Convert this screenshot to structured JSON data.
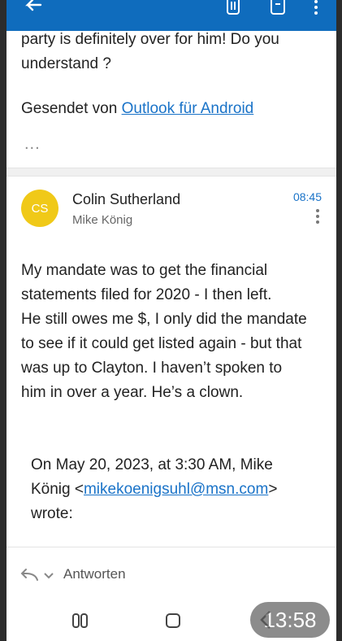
{
  "previous_message": {
    "lines": [
      "party is definitely over for him!  Do you",
      "understand ?"
    ],
    "signature_prefix": "Gesendet von ",
    "signature_link": "Outlook für Android",
    "more": "..."
  },
  "message": {
    "avatar_initials": "CS",
    "sender": "Colin Sutherland",
    "recipient": "Mike König",
    "time": "08:45",
    "body": [
      "My mandate was to get the financial",
      "statements filed for 2020 - I then left.",
      "He still owes me $, I only did the mandate",
      "to see if it could get listed again - but that",
      "was up to Clayton.  I haven’t spoken to",
      "him in over a year.  He’s a clown."
    ],
    "quote_line1": "On May 20, 2023, at 3:30 AM, Mike",
    "quote_name": "König <",
    "quote_email": "mikekoenigsuhl@msn.com",
    "quote_end": ">",
    "quote_wrote": "wrote:"
  },
  "reply": {
    "label": "Antworten"
  },
  "status": {
    "clock": "13:58"
  },
  "colors": {
    "accent": "#0f6cbd",
    "avatar": "#f0c918",
    "link": "#1a73c8"
  },
  "icons": [
    "back-arrow-icon",
    "delete-icon",
    "archive-icon",
    "more-icon",
    "reply-icon",
    "chevron-down-icon",
    "recents-icon",
    "home-icon"
  ]
}
